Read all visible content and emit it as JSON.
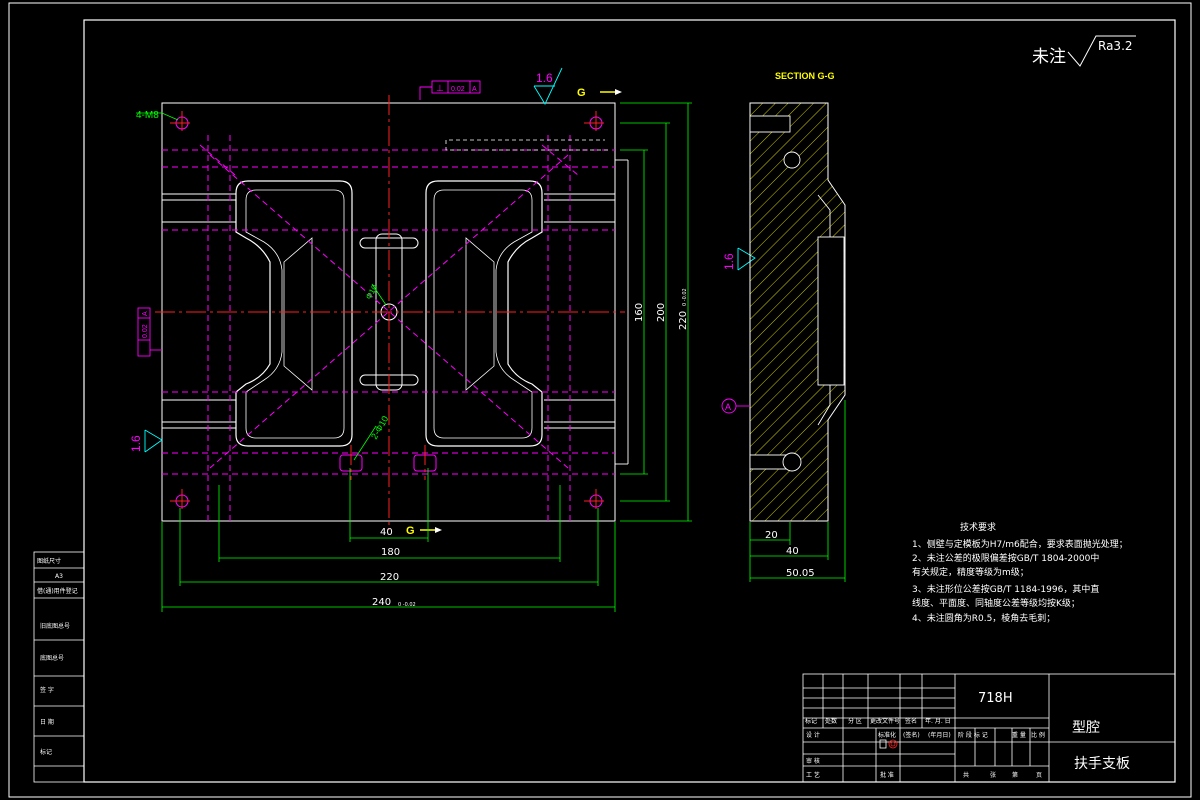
{
  "roughness": {
    "note": "未注",
    "symbol": "Ra3.2"
  },
  "section_title": "SECTION G-G",
  "section_marks": [
    "G",
    "G"
  ],
  "datum": "A",
  "tolerance_frame": {
    "symbol": "⊥",
    "value": "0.02",
    "datum": "A"
  },
  "tol_frame_values": [
    "0.02",
    "A"
  ],
  "finish_marks": [
    "1.6",
    "1.6",
    "1.6"
  ],
  "callouts": {
    "holes": "4-M8",
    "slot": "2-Φ10",
    "center_hole": "Φ10"
  },
  "dims_front": [
    "40",
    "180",
    "220",
    "240"
  ],
  "dims_front_tol": "0\n-0.02",
  "dims_vertical": [
    "160",
    "200",
    "220"
  ],
  "dims_vertical_tol": "0\n-0.02",
  "dims_section": [
    "20",
    "40",
    "50.05"
  ],
  "tech_req": {
    "title": "技术要求",
    "items": [
      "1、侧壁与定模板为H7/m6配合，要求表面抛光处理；",
      "2、未注公差的极限偏差按GB/T 1804-2000中",
      "   有关规定，精度等级为m级；",
      "3、未注形位公差按GB/T 1184-1996，其中直",
      "   线度、平面度、同轴度公差等级均按K级；",
      "4、未注圆角为R0.5，棱角去毛刺；"
    ]
  },
  "left_strip": [
    "图纸尺寸",
    "A3",
    "借(通)用件登记",
    "旧底图总号",
    "底图总号",
    "签 字",
    "日 期",
    "标记"
  ],
  "title_block": {
    "material": "718H",
    "category": "型腔",
    "part_name": "扶手支板",
    "row_labels": [
      "标记",
      "处数",
      "分 区",
      "更改文件号",
      "签名",
      "年. 月. 日"
    ],
    "design_labels": [
      "设 计",
      "标准化",
      "(签名)",
      "(年月日)"
    ],
    "audit_labels": [
      "审 核",
      "工 艺",
      "批 准"
    ],
    "stage_labels": [
      "阶 段 标 记",
      "重 量",
      "比 例"
    ],
    "sheet_labels": [
      "共",
      "张",
      "第",
      "页"
    ]
  }
}
